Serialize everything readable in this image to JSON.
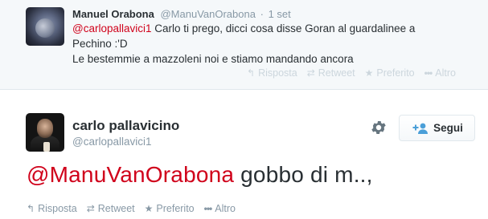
{
  "reply_tweet": {
    "author_name": "Manuel Orabona",
    "handle": "@ManuVanOrabona",
    "separator": "·",
    "date": "1 set",
    "mention": "@carlopallavici1",
    "text_line1": " Carlo ti prego, dicci cosa disse Goran al guardalinee a",
    "text_line2": "Pechino :'D",
    "text_line3": "Le bestemmie a mazzoleni noi e stiamo mandando ancora",
    "actions": {
      "reply": "Risposta",
      "retweet": "Retweet",
      "favorite": "Preferito",
      "more": "Altro"
    }
  },
  "main_tweet": {
    "author_name": "carlo pallavicino",
    "handle": "@carlopallavici1",
    "follow_label": "Segui",
    "mention": "@ManuVanOrabona",
    "text": " gobbo di m..,",
    "actions": {
      "reply": "Risposta",
      "retweet": "Retweet",
      "favorite": "Preferito",
      "more": "Altro"
    }
  },
  "icons": {
    "reply": "reply-arrow-icon",
    "retweet": "retweet-icon",
    "favorite": "star-icon",
    "more": "ellipsis-icon",
    "settings": "gear-icon",
    "follow": "add-user-icon"
  },
  "colors": {
    "mention": "#d0021b",
    "text": "#292f33",
    "muted": "#8899a6",
    "reply_background": "#f5f8fa"
  }
}
